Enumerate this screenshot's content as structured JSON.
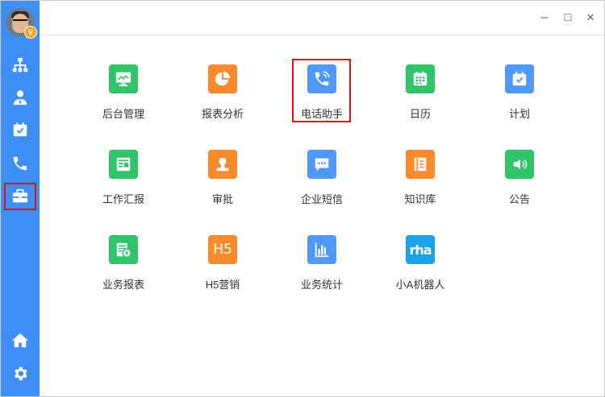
{
  "sidebar": {
    "badge": "V",
    "items": [
      {
        "icon": "org-chart-icon"
      },
      {
        "icon": "contacts-icon"
      },
      {
        "icon": "calendar-check-icon"
      },
      {
        "icon": "phone-icon"
      },
      {
        "icon": "briefcase-icon",
        "active": true
      }
    ],
    "bottom": [
      {
        "icon": "home-icon"
      },
      {
        "icon": "gear-icon"
      }
    ]
  },
  "window_controls": {
    "minimize": "–",
    "maximize": "☐",
    "close": "✕"
  },
  "apps": [
    {
      "label": "后台管理",
      "color": "#2fc36a",
      "icon": "monitor-chart-icon"
    },
    {
      "label": "报表分析",
      "color": "#fa8b2c",
      "icon": "pie-chart-icon"
    },
    {
      "label": "电话助手",
      "color": "#4f98f7",
      "icon": "phone-call-icon"
    },
    {
      "label": "日历",
      "color": "#2fc36a",
      "icon": "calendar-grid-icon"
    },
    {
      "label": "计划",
      "color": "#4f98f7",
      "icon": "calendar-check-icon"
    },
    {
      "label": "工作汇报",
      "color": "#2fc36a",
      "icon": "report-icon"
    },
    {
      "label": "审批",
      "color": "#fa8b2c",
      "icon": "user-stamp-icon"
    },
    {
      "label": "企业短信",
      "color": "#4f98f7",
      "icon": "message-icon"
    },
    {
      "label": "知识库",
      "color": "#fa8b2c",
      "icon": "book-icon"
    },
    {
      "label": "公告",
      "color": "#2fc36a",
      "icon": "speaker-icon"
    },
    {
      "label": "业务报表",
      "color": "#2fc36a",
      "icon": "yen-doc-icon"
    },
    {
      "label": "H5营销",
      "color": "#fa8b2c",
      "icon_text": "H5"
    },
    {
      "label": "业务统计",
      "color": "#4f98f7",
      "icon": "bar-chart-icon"
    },
    {
      "label": "小A机器人",
      "color": "#1aa3e8",
      "icon_text": "rha"
    }
  ]
}
